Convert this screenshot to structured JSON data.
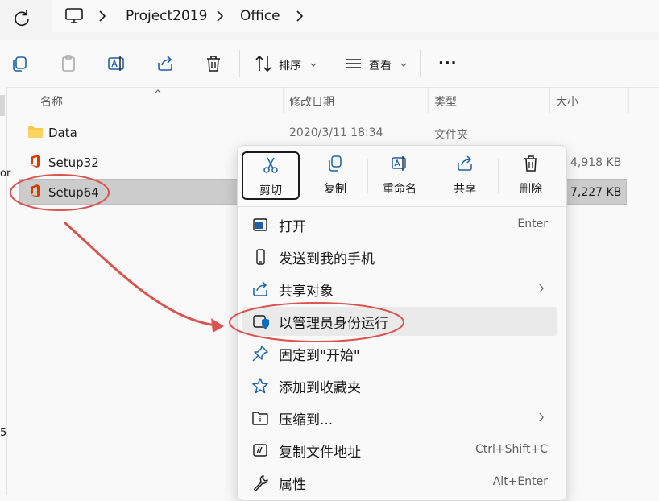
{
  "address": {
    "crumbs": [
      "Project2019",
      "Office"
    ]
  },
  "toolbar": {
    "sort_label": "排序",
    "view_label": "查看",
    "more_label": "···"
  },
  "columns": [
    "名称",
    "修改日期",
    "类型",
    "大小"
  ],
  "files": [
    {
      "name": "Data",
      "date": "2020/3/11 18:34",
      "type": "文件夹",
      "size": "",
      "icon": "folder-icon"
    },
    {
      "name": "Setup32",
      "date": "",
      "type": "",
      "size": "4,918 KB",
      "icon": "office-icon"
    },
    {
      "name": "Setup64",
      "date": "",
      "type": "",
      "size": "7,227 KB",
      "icon": "office-icon",
      "selected": true
    }
  ],
  "left_edge_fragments": [
    "or",
    "5"
  ],
  "context_menu": {
    "quick_actions": [
      {
        "label": "剪切",
        "icon": "scissors-icon"
      },
      {
        "label": "复制",
        "icon": "copy-icon"
      },
      {
        "label": "重命名",
        "icon": "rename-icon"
      },
      {
        "label": "共享",
        "icon": "share-icon"
      },
      {
        "label": "删除",
        "icon": "trash-icon"
      }
    ],
    "items": [
      {
        "label": "打开",
        "shortcut": "Enter",
        "icon": "open-window-icon"
      },
      {
        "label": "发送到我的手机",
        "shortcut": "",
        "icon": "phone-icon"
      },
      {
        "label": "共享对象",
        "shortcut": "",
        "icon": "share-icon",
        "submenu": true
      },
      {
        "label": "以管理员身份运行",
        "shortcut": "",
        "icon": "admin-shield-icon"
      },
      {
        "label": "固定到\"开始\"",
        "shortcut": "",
        "icon": "pin-icon"
      },
      {
        "label": "添加到收藏夹",
        "shortcut": "",
        "icon": "star-icon"
      },
      {
        "label": "压缩到...",
        "shortcut": "",
        "icon": "zip-icon",
        "submenu": true
      },
      {
        "label": "复制文件地址",
        "shortcut": "Ctrl+Shift+C",
        "icon": "copy-path-icon"
      },
      {
        "label": "属性",
        "shortcut": "Alt+Enter",
        "icon": "wrench-icon"
      }
    ]
  },
  "colors": {
    "annotation_red": "#d9534f",
    "admin_shield_blue": "#0f6cbd",
    "office_orange": "#d83b01"
  }
}
